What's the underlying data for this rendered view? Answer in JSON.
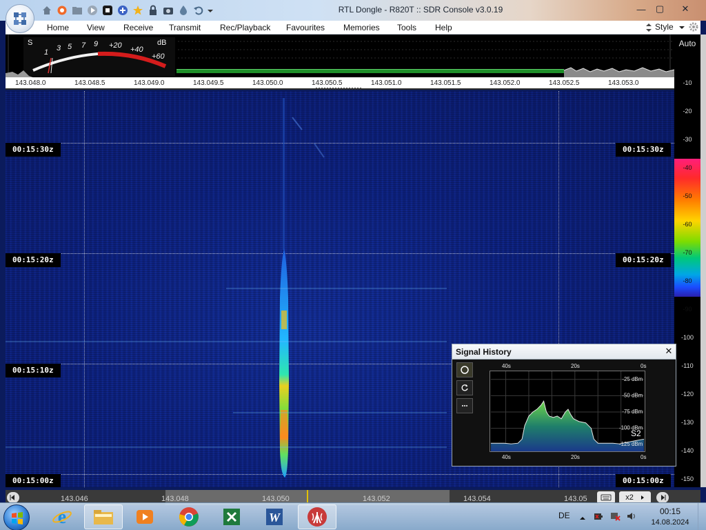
{
  "window": {
    "title": "RTL Dongle - R820T :: SDR Console v3.0.19",
    "minimize": "—",
    "maximize": "▢",
    "close": "✕"
  },
  "menu": {
    "items": [
      "Home",
      "View",
      "Receive",
      "Transmit",
      "Rec/Playback",
      "Favourites",
      "Memories",
      "Tools",
      "Help"
    ],
    "style_label": "Style"
  },
  "smeter": {
    "s_label": "S",
    "db_label": "dB",
    "s_scale": [
      "1",
      "3",
      "5",
      "7",
      "9"
    ],
    "db_scale": [
      "+20",
      "+40",
      "+60"
    ]
  },
  "scale_mode": "Auto",
  "frequency_axis": {
    "ticks": [
      "143.048.0",
      "143.048.5",
      "143.049.0",
      "143.049.5",
      "143.050.0",
      "143.050.5",
      "143.051.0",
      "143.051.5",
      "143.052.0",
      "143.052.5",
      "143.053.0"
    ]
  },
  "waterfall": {
    "time_labels": [
      "00:15:30z",
      "00:15:20z",
      "00:15:10z",
      "00:15:00z"
    ]
  },
  "db_scale": {
    "ticks": [
      "-10",
      "-20",
      "-30",
      "-40",
      "-50",
      "-60",
      "-70",
      "-80",
      "-90",
      "-100",
      "-110",
      "-120",
      "-130",
      "-140",
      "-150"
    ]
  },
  "signal_history": {
    "title": "Signal History",
    "close_label": "✕",
    "time_axis": [
      "40s",
      "20s",
      "0s"
    ],
    "level_axis": [
      "-25 dBm",
      "-50 dBm",
      "-75 dBm",
      "-100 dBm",
      "-125 dBm"
    ],
    "s_reading": "S2"
  },
  "bottom_bar": {
    "frequencies": [
      "143.046",
      "143.048",
      "143.050",
      "143.052",
      "143.054",
      "143.05"
    ],
    "zoom_label": "x2"
  },
  "taskbar": {
    "apps": [
      "internet-explorer",
      "file-explorer",
      "media-player",
      "chrome",
      "excel",
      "word",
      "sdr-console"
    ],
    "language": "DE",
    "time": "00:15",
    "date": "14.08.2024"
  }
}
